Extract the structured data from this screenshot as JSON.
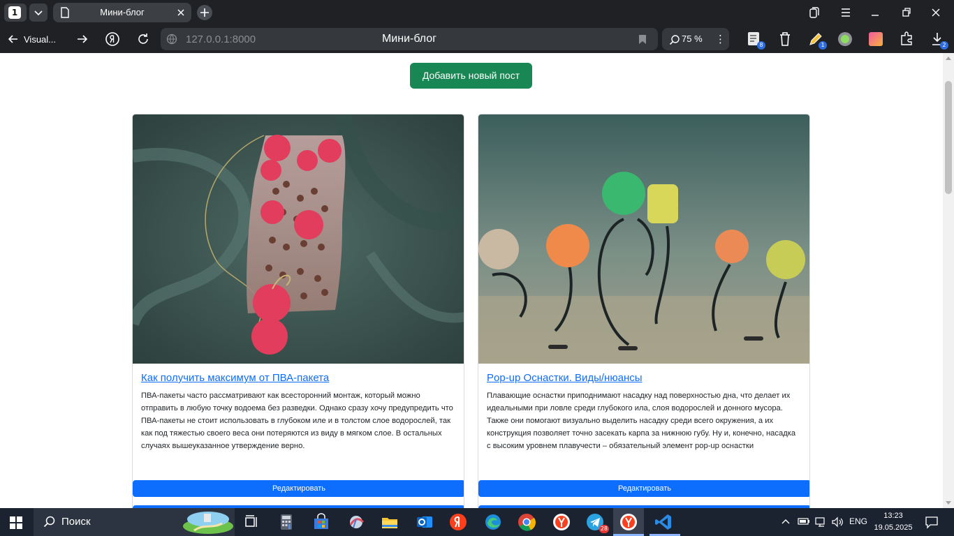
{
  "browser": {
    "tab_count": "1",
    "tab_title": "Мини-блог",
    "back_label": "Visual...",
    "url": "127.0.0.1:8000",
    "page_title": "Мини-блог",
    "zoom": "75 %",
    "ext_badges": [
      "8",
      "1",
      "2"
    ],
    "icons": [
      "tab-list-icon",
      "page-icon",
      "close-icon",
      "plus-icon",
      "collections-icon",
      "menu-icon",
      "minimize-icon",
      "restore-icon",
      "window-close-icon",
      "back-icon",
      "forward-icon",
      "yandex-icon",
      "reload-icon",
      "site-info-icon",
      "bookmark-icon",
      "zoom-icon",
      "more-icon",
      "downloads-icon"
    ]
  },
  "page": {
    "add_button": "Добавить новый пост",
    "posts": [
      {
        "title": "Как получить максимум от ПВА-пакета",
        "text": "ПВА-пакеты часто рассматривают как всесторонний монтаж, который можно отправить в любую точку водоема без разведки. Однако сразу хочу предупредить что ПВА-пакеты не стоит использовать в глубоком иле и в толстом слое водорослей, так как под тяжестью своего веса они потеряются из виду в мягком слое. В остальных случаях вышеуказанное утверждение верно.",
        "edit_label": "Редактировать",
        "image": "pva-bag-photo"
      },
      {
        "title": "Pop-up Оснастки. Виды/нюансы",
        "text": "Плавающие оснастки приподнимают насадку над поверхностью дна, что делает их идеальными при ловле среди глубокого ила, слоя водорослей и донного мусора. Также они помогают визуально выделить насадку среди всего окружения, а их конструкция позволяет точно засекать карпа за нижнюю губу. Ну и, конечно, насадка с высоким уровнем плавучести – обязательный элемент pop-up оснастки",
        "edit_label": "Редактировать",
        "image": "pop-up-rigs-photo"
      }
    ]
  },
  "taskbar": {
    "search_placeholder": "Поиск",
    "telegram_badge": "28",
    "lang": "ENG",
    "time": "13:23",
    "date": "19.05.2025",
    "apps": [
      "task-view-icon",
      "calculator-icon",
      "store-icon",
      "app-icon",
      "explorer-icon",
      "outlook-icon",
      "yandex-icon",
      "edge-icon",
      "chrome-icon",
      "yandex-browser-icon",
      "telegram-icon",
      "yandex-browser-active-icon",
      "vscode-icon"
    ]
  },
  "colors": {
    "chrome_bg": "#1f2125",
    "add_button": "#198754",
    "primary": "#0d6efd",
    "taskbar_bg": "#1c2330"
  }
}
